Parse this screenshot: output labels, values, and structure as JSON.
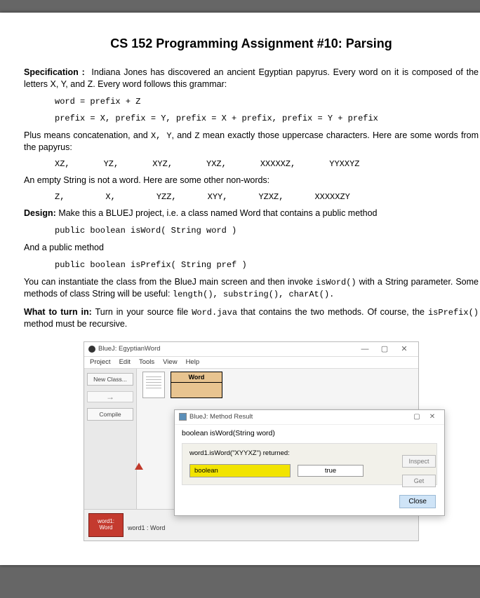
{
  "title": "CS 152 Programming Assignment #10: Parsing",
  "spec": {
    "heading": "Specification :",
    "para1": "Indiana Jones has discovered an ancient Egyptian papyrus.  Every word on it is composed of the letters X, Y, and Z.  Every word follows this grammar:",
    "grammar1": "word = prefix + Z",
    "grammar2": "prefix = X,   prefix = Y,   prefix = X + prefix,    prefix = Y + prefix",
    "para2a": "Plus means concatenation, and ",
    "xyz": "X, Y",
    "and": ", and ",
    "z": "Z",
    "para2b": " mean exactly those uppercase characters. Here are some words from the papyrus:",
    "words": [
      "XZ,",
      "YZ,",
      "XYZ,",
      "YXZ,",
      "XXXXXZ,",
      "YYXXYZ"
    ],
    "para3": "An empty String is not a word. Here are some other non-words:",
    "nonwords": [
      "Z,",
      "X,",
      "YZZ,",
      "XYY,",
      "YZXZ,",
      "XXXXXZY"
    ]
  },
  "design": {
    "heading": "Design:",
    "text": " Make this a BLUEJ project, i.e. a class named Word that contains a public method",
    "sig1": "public boolean isWord( String word )",
    "text2": "And a public method",
    "sig2": "public boolean isPrefix( String pref )",
    "para4a": "You can instantiate the class from the BlueJ main screen and then invoke ",
    "isword": "isWord()",
    "para4b": " with a String parameter. Some methods of class String will be useful: ",
    "methods": "length(), substring(), charAt()."
  },
  "turnin": {
    "heading": "What to turn in:",
    "text1": "  Turn in your source file ",
    "file": "Word.java",
    "text2": "  that contains the two methods. Of course, the ",
    "isprefix": "isPrefix()",
    "text3": "  method must be recursive."
  },
  "bluej": {
    "windowTitle": "BlueJ:  EgyptianWord",
    "menus": [
      "Project",
      "Edit",
      "Tools",
      "View",
      "Help"
    ],
    "sidebar": {
      "newClass": "New Class...",
      "compile": "Compile"
    },
    "className": "Word",
    "bench": {
      "obj1": "word1:",
      "obj2": "Word",
      "label": "word1 : Word"
    },
    "dialog": {
      "title": "BlueJ:  Method Result",
      "signature": "boolean isWord(String word)",
      "returned": "word1.isWord(\"XYYXZ\") returned:",
      "typeLabel": "boolean",
      "value": "true",
      "inspect": "Inspect",
      "get": "Get",
      "close": "Close"
    }
  }
}
